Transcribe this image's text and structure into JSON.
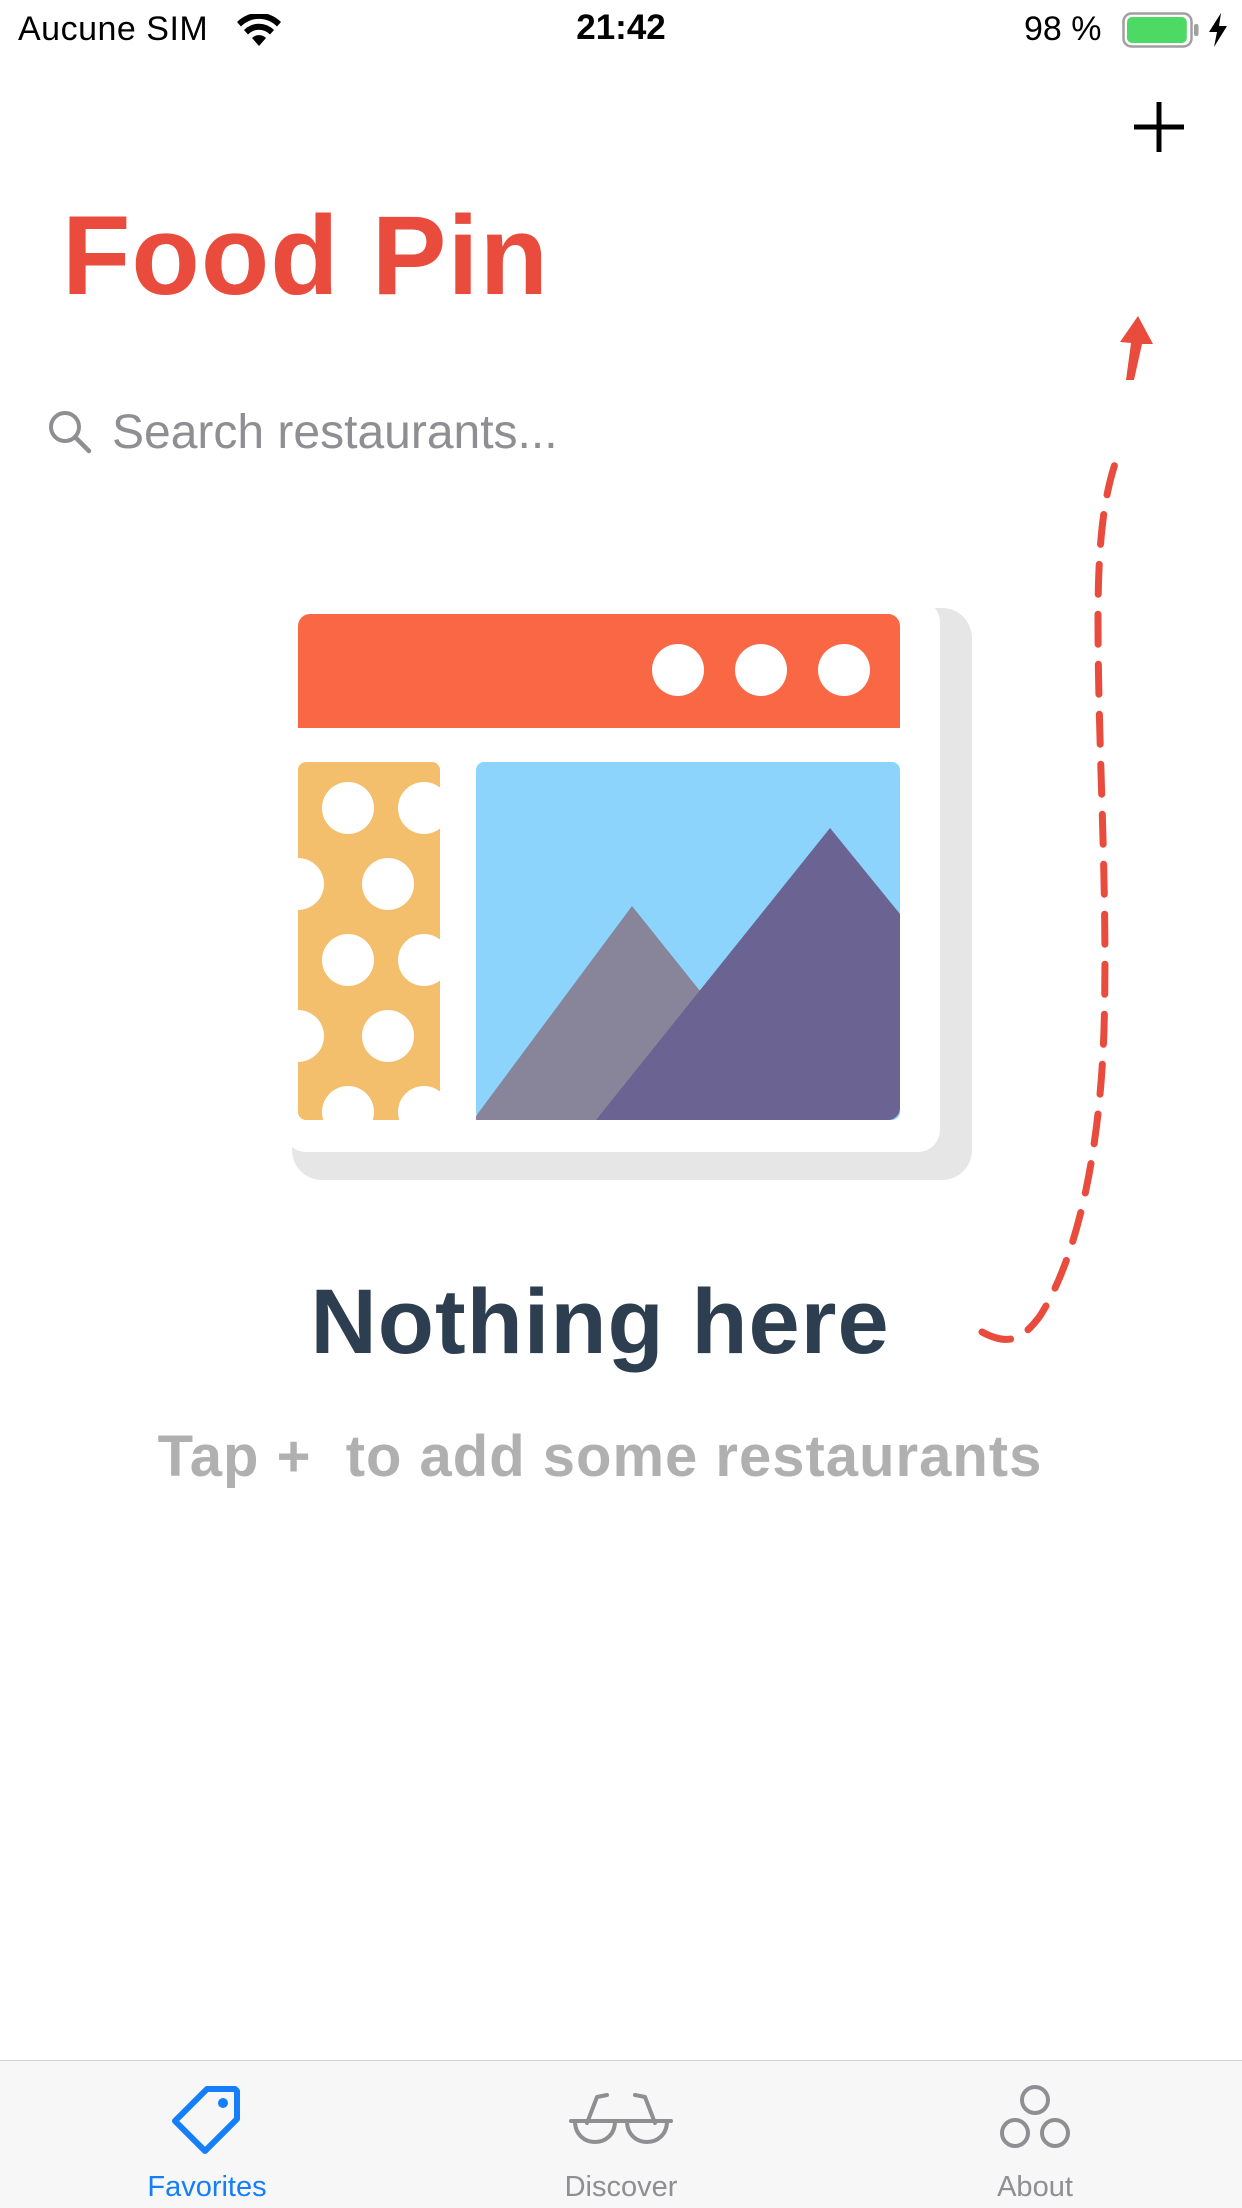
{
  "status_bar": {
    "carrier": "Aucune SIM",
    "time": "21:42",
    "battery_percent": "98 %",
    "battery_level": 0.98,
    "battery_color": "#4cd964"
  },
  "nav": {
    "add_icon": "plus-icon"
  },
  "header": {
    "title": "Food Pin",
    "title_color": "#e94b3c"
  },
  "search": {
    "placeholder": "Search restaurants...",
    "value": ""
  },
  "empty_state": {
    "illustration": "empty-window-illustration",
    "title": "Nothing here",
    "subtitle": "Tap +  to add some restaurants",
    "arrow_color": "#e94b3c"
  },
  "tab_bar": {
    "active_color": "#147efb",
    "inactive_color": "#8e8e93",
    "tabs": [
      {
        "label": "Favorites",
        "icon": "tag-icon",
        "active": true
      },
      {
        "label": "Discover",
        "icon": "glasses-icon",
        "active": false
      },
      {
        "label": "About",
        "icon": "circles-icon",
        "active": false
      }
    ]
  }
}
